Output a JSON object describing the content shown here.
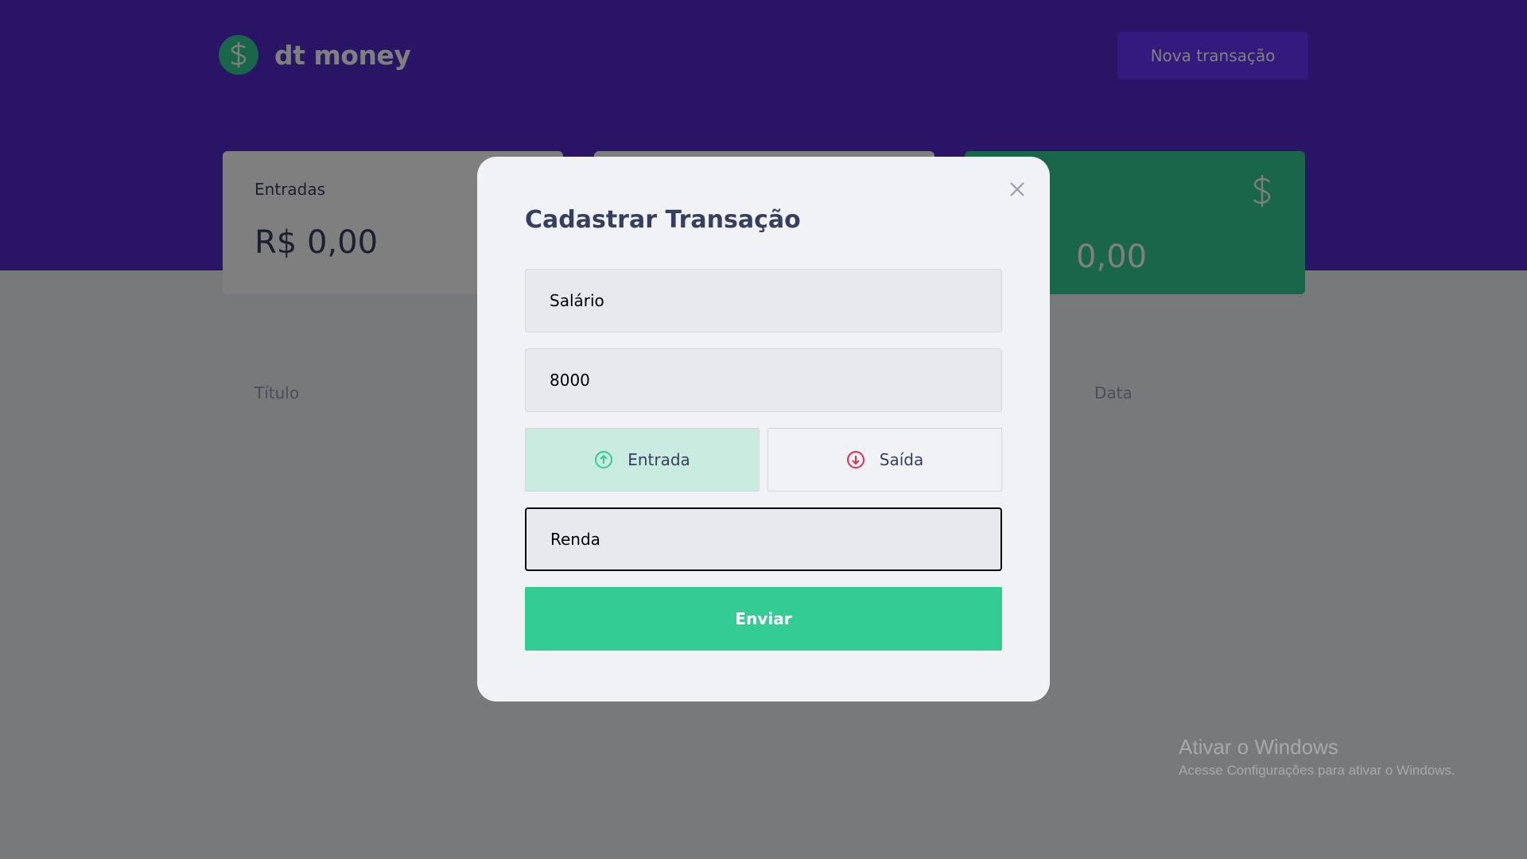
{
  "header": {
    "logo_text": "dt money",
    "new_transaction_label": "Nova transação"
  },
  "summary": {
    "income_label": "Entradas",
    "income_value": "R$ 0,00",
    "total_value_partial": "0,00"
  },
  "table": {
    "headers": [
      "Título",
      "Data"
    ]
  },
  "modal": {
    "title": "Cadastrar Transação",
    "title_value": "Salário",
    "amount_value": "8000",
    "type_income_label": "Entrada",
    "type_outcome_label": "Saída",
    "selected_type": "Entrada",
    "category_value": "Renda",
    "submit_label": "Enviar"
  },
  "watermark": {
    "title": "Ativar o Windows",
    "subtitle": "Acesse Configurações para ativar o Windows."
  },
  "colors": {
    "header_bg": "#5429cc",
    "button_bg": "#6933ff",
    "green": "#33cc95",
    "red": "#e52e4d",
    "text": "#363f5f"
  },
  "icons": {
    "logo": "dollar-circle-icon",
    "close": "close-icon",
    "income": "arrow-up-circle-icon",
    "outcome": "arrow-down-circle-icon",
    "total": "dollar-icon"
  }
}
